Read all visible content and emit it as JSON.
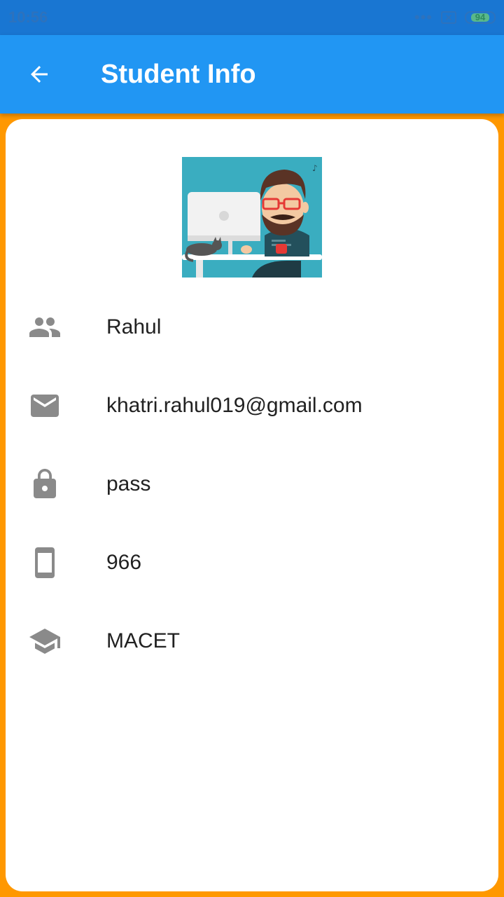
{
  "status_bar": {
    "time": "10:56",
    "battery": "94"
  },
  "app_bar": {
    "title": "Student Info"
  },
  "student": {
    "name": "Rahul",
    "email": "khatri.rahul019@gmail.com",
    "password": "pass",
    "phone": "966",
    "college": "MACET"
  },
  "icons": {
    "back": "arrow-back-icon",
    "name": "people-icon",
    "email": "mail-icon",
    "password": "lock-icon",
    "phone": "smartphone-icon",
    "college": "school-icon"
  },
  "colors": {
    "app_bar": "#2196F3",
    "status_bar": "#1976D2",
    "background": "#FF9800",
    "icon": "#8a8a8a"
  }
}
